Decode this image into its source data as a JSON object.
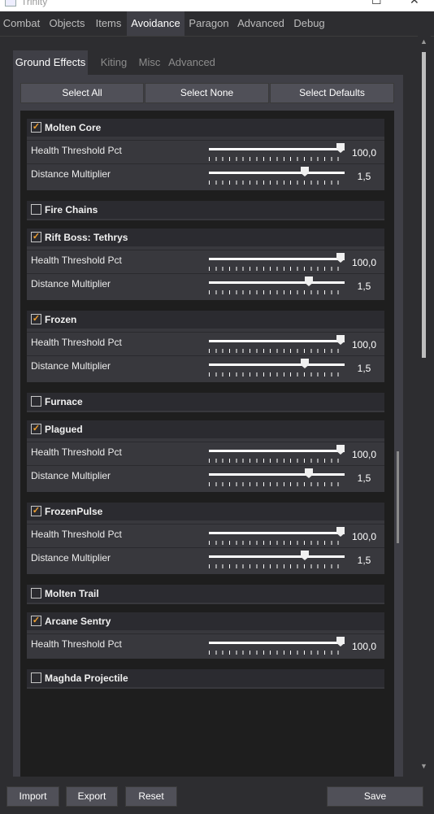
{
  "window": {
    "title": "Trinity"
  },
  "main_tabs": [
    "Combat",
    "Objects",
    "Items",
    "Avoidance",
    "Paragon",
    "Advanced",
    "Debug"
  ],
  "main_active": "Avoidance",
  "sub_tabs": [
    "Ground Effects",
    "Kiting",
    "Misc",
    "Advanced"
  ],
  "sub_active": "Ground Effects",
  "selection_buttons": [
    "Select All",
    "Select None",
    "Select Defaults"
  ],
  "labels": {
    "health": "Health Threshold Pct",
    "distance": "Distance Multiplier"
  },
  "avoidances": [
    {
      "name": "Molten Core",
      "checked": true,
      "health": "100,0",
      "health_level": 1.0,
      "distance": "1,5",
      "distance_level": 0.72
    },
    {
      "name": "Fire Chains",
      "checked": false
    },
    {
      "name": "Rift Boss: Tethrys",
      "checked": true,
      "health": "100,0",
      "health_level": 1.0,
      "distance": "1,5",
      "distance_level": 0.75
    },
    {
      "name": "Frozen",
      "checked": true,
      "health": "100,0",
      "health_level": 1.0,
      "distance": "1,5",
      "distance_level": 0.72
    },
    {
      "name": "Furnace",
      "checked": false
    },
    {
      "name": "Plagued",
      "checked": true,
      "health": "100,0",
      "health_level": 1.0,
      "distance": "1,5",
      "distance_level": 0.75
    },
    {
      "name": "FrozenPulse",
      "checked": true,
      "health": "100,0",
      "health_level": 1.0,
      "distance": "1,5",
      "distance_level": 0.72
    },
    {
      "name": "Molten Trail",
      "checked": false
    },
    {
      "name": "Arcane Sentry",
      "checked": true,
      "health": "100,0",
      "health_level": 1.0
    },
    {
      "name": "Maghda Projectile",
      "checked": false
    }
  ],
  "footer": {
    "import": "Import",
    "export": "Export",
    "reset": "Reset",
    "save": "Save"
  },
  "colors": {
    "check_accent": "#f0a030",
    "active_tab_bg": "#3f3f46",
    "list_bg": "#1e1e1e"
  }
}
